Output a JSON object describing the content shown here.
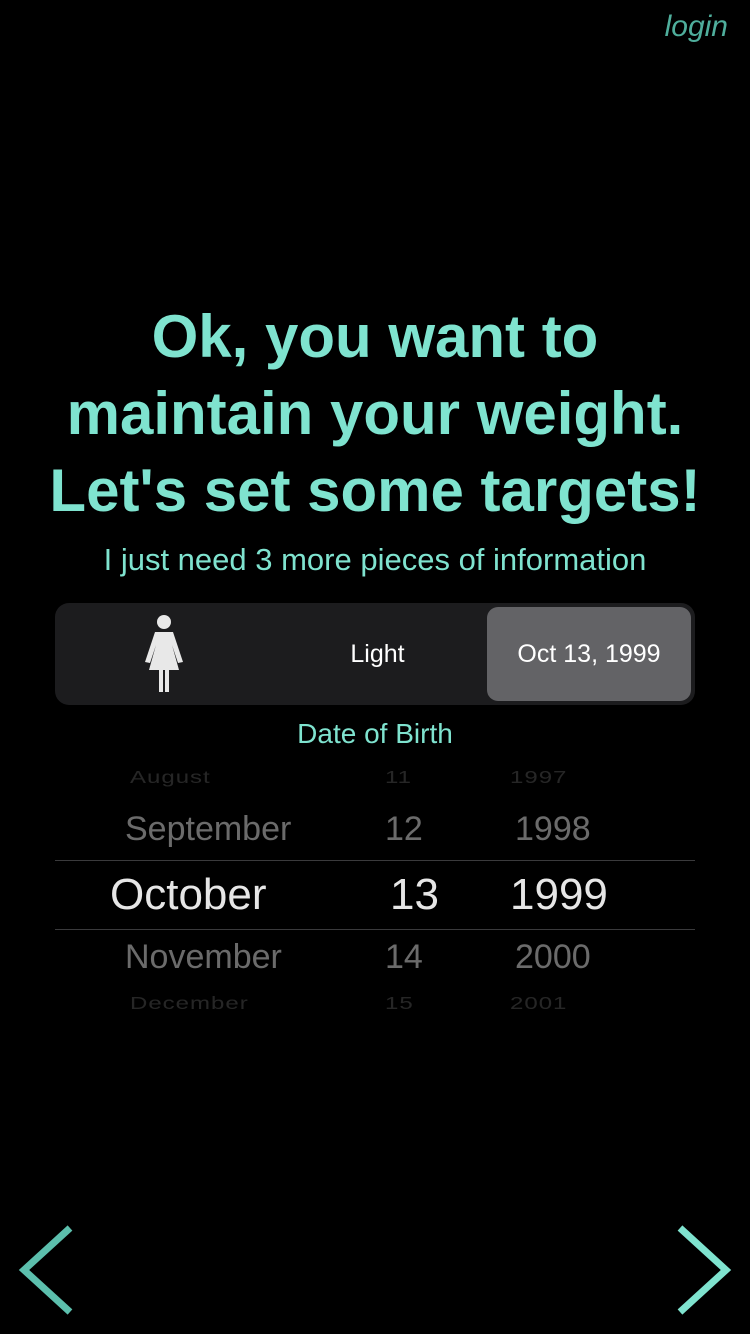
{
  "header": {
    "login_label": "login"
  },
  "headline": {
    "line1": "Ok, you want to",
    "line2": "maintain your weight.",
    "line3": "Let's set some targets!"
  },
  "subtitle": "I just need 3 more pieces of information",
  "segments": {
    "gender_icon": "female-person-icon",
    "activity_label": "Light",
    "dob_label": "Oct 13, 1999"
  },
  "field_label": "Date of Birth",
  "picker": {
    "months": [
      "August",
      "September",
      "October",
      "November",
      "December"
    ],
    "days": [
      "11",
      "12",
      "13",
      "14",
      "15"
    ],
    "years": [
      "1997",
      "1998",
      "1999",
      "2000",
      "2001"
    ]
  },
  "nav": {
    "back_icon": "chevron-left-icon",
    "next_icon": "chevron-right-icon"
  },
  "colors": {
    "accent": "#7fe3cf",
    "login": "#4fae9c",
    "background": "#000000",
    "segment_bg": "#1c1c1e",
    "segment_selected": "#636366"
  }
}
